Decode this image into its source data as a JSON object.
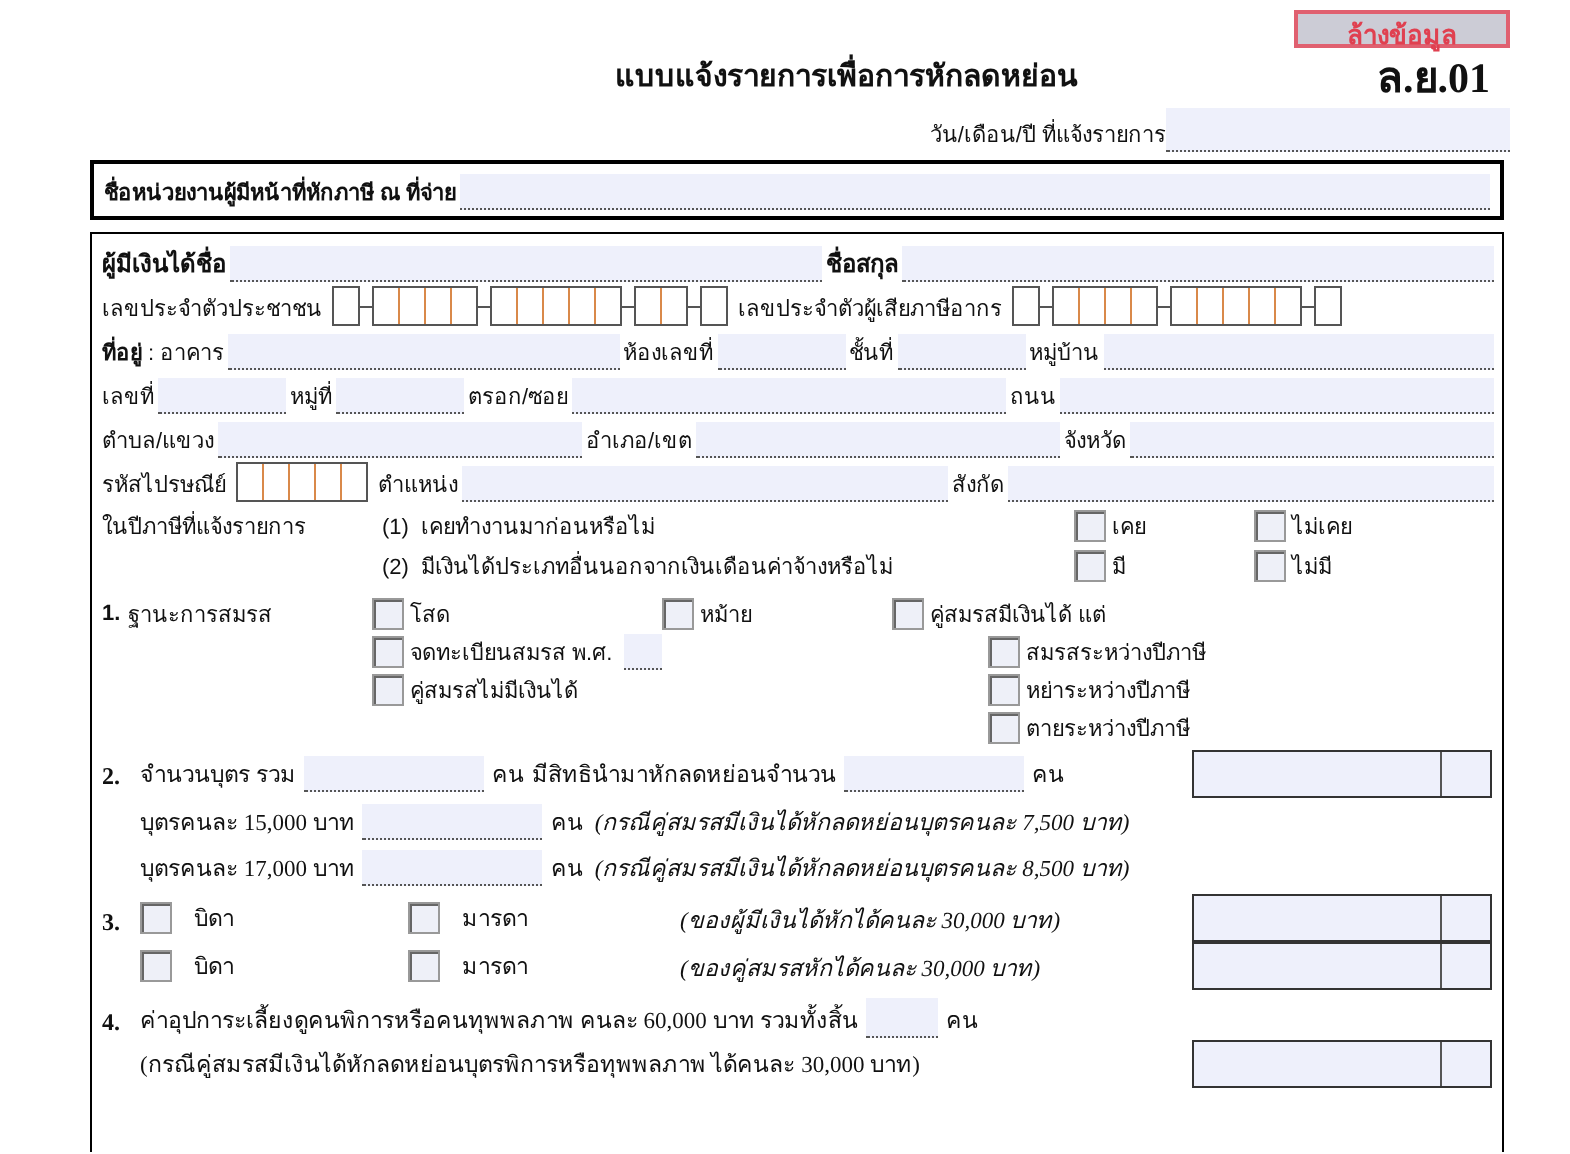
{
  "clear_button": "ล้างข้อมูล",
  "title": "แบบแจ้งรายการเพื่อการหักลดหย่อน",
  "form_code": "ล.ย.01",
  "date_label": "วัน/เดือน/ปี ที่แจ้งรายการ",
  "employer_label": "ชื่อหน่วยงานผู้มีหน้าที่หักภาษี ณ ที่จ่าย",
  "payee_rows": [
    [
      {
        "kind": "bold_label",
        "text": "ผู้มีเงินได้ชื่อ"
      },
      {
        "kind": "field"
      },
      {
        "kind": "bold_label",
        "text": "ชื่อสกุล"
      },
      {
        "kind": "field"
      }
    ],
    [
      {
        "kind": "label",
        "text": "เลขประจำตัวประชาชน"
      },
      {
        "kind": "citizen_id"
      },
      {
        "kind": "label",
        "text": "เลขประจำตัวผู้เสียภาษีอากร"
      },
      {
        "kind": "tax_id"
      }
    ],
    [
      {
        "kind": "label",
        "text": "**ที่อยู่** : อาคาร"
      },
      {
        "kind": "field"
      },
      {
        "kind": "label",
        "text": "ห้องเลขที่"
      },
      {
        "kind": "short_field"
      },
      {
        "kind": "label",
        "text": "ชั้นที่"
      },
      {
        "kind": "short_field"
      },
      {
        "kind": "label",
        "text": "หมู่บ้าน"
      },
      {
        "kind": "field"
      }
    ],
    [
      {
        "kind": "label",
        "text": "เลขที่"
      },
      {
        "kind": "short_field"
      },
      {
        "kind": "label",
        "text": "หมู่ที่"
      },
      {
        "kind": "short_field"
      },
      {
        "kind": "label",
        "text": "ตรอก/ซอย"
      },
      {
        "kind": "field"
      },
      {
        "kind": "label",
        "text": "ถนน"
      },
      {
        "kind": "field"
      }
    ],
    [
      {
        "kind": "label",
        "text": "ตำบล/แขวง"
      },
      {
        "kind": "field"
      },
      {
        "kind": "label",
        "text": "อำเภอ/เขต"
      },
      {
        "kind": "field"
      },
      {
        "kind": "label",
        "text": "จังหวัด"
      },
      {
        "kind": "field"
      }
    ],
    [
      {
        "kind": "label",
        "text": "รหัสไปรษณีย์"
      },
      {
        "kind": "postcode"
      },
      {
        "kind": "label",
        "text": "ตำแหน่ง"
      },
      {
        "kind": "field"
      },
      {
        "kind": "label",
        "text": "สังกัด"
      },
      {
        "kind": "field"
      }
    ]
  ],
  "tax_year_label": "ในปีภาษีที่แจ้งรายการ",
  "questions": [
    {
      "number": "(1)",
      "text": "เคยทำงานมาก่อนหรือไม่",
      "options": [
        {
          "label": "เคย",
          "checked": false
        },
        {
          "label": "ไม่เคย",
          "checked": false
        }
      ]
    },
    {
      "number": "(2)",
      "text": "มีเงินได้ประเภทอื่นนอกจากเงินเดือนค่าจ้างหรือไม่",
      "options": [
        {
          "label": "มี",
          "checked": false
        },
        {
          "label": "ไม่มี",
          "checked": false
        }
      ]
    }
  ],
  "marital": {
    "number": "1.",
    "title": "ฐานะการสมรส",
    "columns": [
      [
        {
          "label": "โสด",
          "checked": false
        },
        {
          "label": "จดทะเบียนสมรส พ.ศ.",
          "checked": false,
          "has_field": true
        },
        {
          "label": "คู่สมรสไม่มีเงินได้",
          "checked": false
        }
      ],
      [
        {
          "label": "หม้าย",
          "checked": false
        }
      ],
      [
        {
          "label": "คู่สมรสมีเงินได้ แต่",
          "checked": false,
          "children": [
            {
              "label": "สมรสระหว่างปีภาษี",
              "checked": false
            },
            {
              "label": "หย่าระหว่างปีภาษี",
              "checked": false
            },
            {
              "label": "ตายระหว่างปีภาษี",
              "checked": false
            }
          ]
        }
      ]
    ]
  },
  "sections": [
    {
      "number": "2.",
      "rows": [
        {
          "amount": true,
          "items": [
            {
              "kind": "text",
              "text": "จำนวนบุตร รวม"
            },
            {
              "kind": "field"
            },
            {
              "kind": "text",
              "text": "คน"
            },
            {
              "kind": "text",
              "text": "มีสิทธินำมาหักลดหย่อนจำนวน"
            },
            {
              "kind": "field"
            },
            {
              "kind": "text",
              "text": "คน"
            }
          ]
        },
        {
          "amount": false,
          "items": [
            {
              "kind": "text",
              "text": "บุตรคนละ 15,000 บาท"
            },
            {
              "kind": "field"
            },
            {
              "kind": "text",
              "text": "คน"
            },
            {
              "kind": "note",
              "text": "(กรณีคู่สมรสมีเงินได้หักลดหย่อนบุตรคนละ 7,500 บาท)"
            }
          ]
        },
        {
          "amount": false,
          "items": [
            {
              "kind": "text",
              "text": "บุตรคนละ 17,000 บาท"
            },
            {
              "kind": "field"
            },
            {
              "kind": "text",
              "text": "คน"
            },
            {
              "kind": "note",
              "text": "(กรณีคู่สมรสมีเงินได้หักลดหย่อนบุตรคนละ 8,500 บาท)"
            }
          ]
        }
      ]
    },
    {
      "number": "3.",
      "rows": [
        {
          "amount": true,
          "items": [
            {
              "kind": "checkbox",
              "label": "บิดา",
              "checked": false
            },
            {
              "kind": "checkbox",
              "label": "มารดา",
              "checked": false
            },
            {
              "kind": "note",
              "text": "(ของผู้มีเงินได้หักได้คนละ 30,000 บาท)"
            }
          ]
        },
        {
          "amount": true,
          "items": [
            {
              "kind": "checkbox",
              "label": "บิดา",
              "checked": false
            },
            {
              "kind": "checkbox",
              "label": "มารดา",
              "checked": false
            },
            {
              "kind": "note",
              "text": "(ของคู่สมรสหักได้คนละ 30,000 บาท)"
            }
          ]
        }
      ]
    },
    {
      "number": "4.",
      "rows": [
        {
          "amount": false,
          "items": [
            {
              "kind": "text",
              "text": "ค่าอุปการะเลี้ยงดูคนพิการหรือคนทุพพลภาพ  คนละ 60,000 บาท รวมทั้งสิ้น"
            },
            {
              "kind": "tiny_field"
            },
            {
              "kind": "text",
              "text": "คน"
            }
          ]
        },
        {
          "amount": true,
          "items": [
            {
              "kind": "text",
              "text": "(กรณีคู่สมรสมีเงินได้หักลดหย่อนบุตรพิการหรือทุพพลภาพ ได้คนละ 30,000 บาท)"
            }
          ]
        }
      ]
    }
  ]
}
